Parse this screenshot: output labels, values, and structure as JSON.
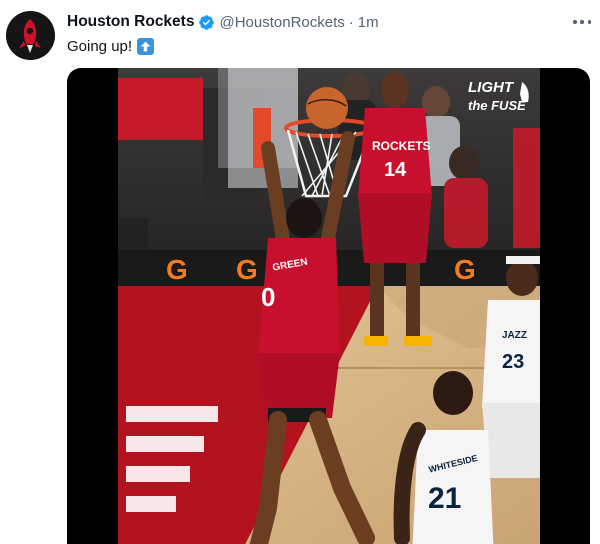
{
  "tweet": {
    "author_name": "Houston Rockets",
    "handle": "@HoustonRockets",
    "separator": "·",
    "time": "1m",
    "text": "Going up!",
    "emoji_icon": "up-arrow-emoji-icon",
    "more_icon": "more-options-icon",
    "verified_icon": "verified-badge-icon"
  },
  "media": {
    "overlay_logo_line1": "LIGHT",
    "overlay_logo_line2": "the FUSE",
    "player_dunking_name": "GREEN",
    "player_dunking_number": "0",
    "bench_player_team": "ROCKETS",
    "bench_player_number": "14",
    "defender_team": "JAZZ",
    "defender_number_1": "23",
    "defender_name_2": "WHITESIDE",
    "defender_number_2": "21",
    "courtside_sponsor": "G"
  },
  "colors": {
    "rockets_red": "#c8102e",
    "brand_blue": "#1d9bf0",
    "court_wood": "#d8b88a",
    "court_red": "#b3121f"
  }
}
